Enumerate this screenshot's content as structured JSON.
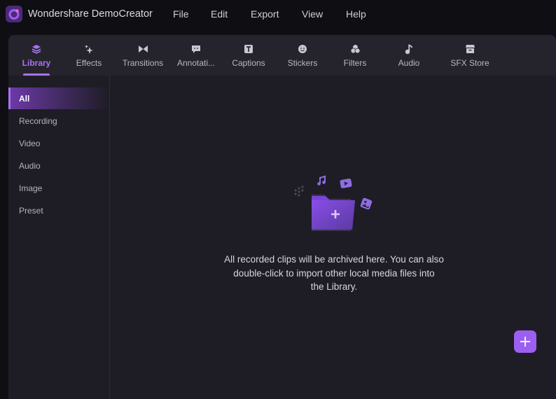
{
  "app": {
    "title": "Wondershare DemoCreator",
    "accent": "#a774f0"
  },
  "menu": [
    {
      "label": "File"
    },
    {
      "label": "Edit"
    },
    {
      "label": "Export"
    },
    {
      "label": "View"
    },
    {
      "label": "Help"
    }
  ],
  "tabs": [
    {
      "label": "Library",
      "icon": "layers-icon",
      "active": true
    },
    {
      "label": "Effects",
      "icon": "sparkle-icon"
    },
    {
      "label": "Transitions",
      "icon": "bowtie-icon"
    },
    {
      "label": "Annotati...",
      "icon": "speech-bubble-icon"
    },
    {
      "label": "Captions",
      "icon": "text-t-icon"
    },
    {
      "label": "Stickers",
      "icon": "smiley-icon"
    },
    {
      "label": "Filters",
      "icon": "circles-icon"
    },
    {
      "label": "Audio",
      "icon": "music-note-icon"
    },
    {
      "label": "SFX Store",
      "icon": "store-icon"
    }
  ],
  "sidebar": {
    "items": [
      {
        "label": "All",
        "active": true
      },
      {
        "label": "Recording"
      },
      {
        "label": "Video"
      },
      {
        "label": "Audio"
      },
      {
        "label": "Image"
      },
      {
        "label": "Preset"
      }
    ]
  },
  "main": {
    "empty_message_line1": "All recorded clips will be archived here. You can also",
    "empty_message_line2": "double-click to import other local media files into",
    "empty_message_line3": "the Library.",
    "add_button_label": "+"
  }
}
